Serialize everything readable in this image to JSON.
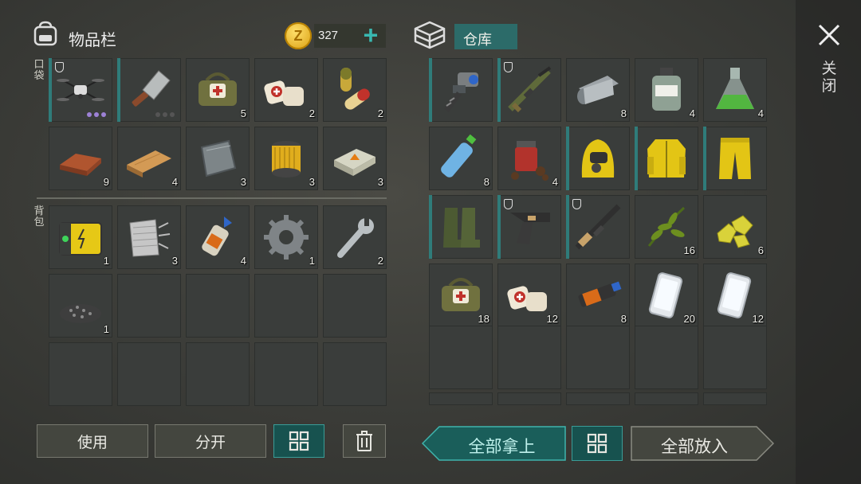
{
  "inventory": {
    "title": "物品栏",
    "pocket_label": "口袋",
    "backpack_label": "背包",
    "coins": "327",
    "coin_symbol": "Z",
    "add_symbol": "+",
    "pocket_slots": [
      {
        "icon": "drone-icon",
        "count": "",
        "shield": true,
        "dots": "purple",
        "rarity": true
      },
      {
        "icon": "cleaver-icon",
        "count": "",
        "shield": false,
        "dots": "gray",
        "rarity": true
      },
      {
        "icon": "medkit-bag-icon",
        "count": "5"
      },
      {
        "icon": "bandage-icon",
        "count": "2"
      },
      {
        "icon": "pills-icon",
        "count": "2"
      },
      {
        "icon": "copper-bar-icon",
        "count": "9"
      },
      {
        "icon": "wood-plank-icon",
        "count": "4"
      },
      {
        "icon": "metal-plate-icon",
        "count": "3"
      },
      {
        "icon": "filter-icon",
        "count": "3"
      },
      {
        "icon": "explosive-block-icon",
        "count": "3"
      }
    ],
    "backpack_slots": [
      {
        "icon": "battery-icon",
        "count": "1"
      },
      {
        "icon": "cloth-icon",
        "count": "3"
      },
      {
        "icon": "glue-icon",
        "count": "4"
      },
      {
        "icon": "gear-icon",
        "count": "1"
      },
      {
        "icon": "wrench-icon",
        "count": "2"
      },
      {
        "icon": "gravel-icon",
        "count": "1"
      },
      {
        "icon": "empty",
        "count": ""
      },
      {
        "icon": "empty",
        "count": ""
      },
      {
        "icon": "empty",
        "count": ""
      },
      {
        "icon": "empty",
        "count": ""
      },
      {
        "icon": "empty",
        "count": ""
      },
      {
        "icon": "empty",
        "count": ""
      },
      {
        "icon": "empty",
        "count": ""
      },
      {
        "icon": "empty",
        "count": ""
      },
      {
        "icon": "empty",
        "count": ""
      }
    ],
    "buttons": {
      "use": "使用",
      "split": "分开"
    }
  },
  "storage": {
    "title": "仓库",
    "slots": [
      {
        "icon": "drill-icon",
        "count": "",
        "rarity": true
      },
      {
        "icon": "rifle-icon",
        "count": "",
        "shield": true,
        "rarity": true
      },
      {
        "icon": "fabric-roll-icon",
        "count": "8"
      },
      {
        "icon": "chemical-bottle-icon",
        "count": "4"
      },
      {
        "icon": "flask-icon",
        "count": "4"
      },
      {
        "icon": "water-bottle-icon",
        "count": "8"
      },
      {
        "icon": "spice-jar-icon",
        "count": "4"
      },
      {
        "icon": "hazmat-hood-icon",
        "count": "",
        "rarity": true
      },
      {
        "icon": "hazmat-jacket-icon",
        "count": "",
        "rarity": true
      },
      {
        "icon": "hazmat-pants-icon",
        "count": "",
        "rarity": true
      },
      {
        "icon": "rubber-boots-icon",
        "count": "",
        "rarity": true
      },
      {
        "icon": "pistol-icon",
        "count": "",
        "shield": true,
        "rarity": true
      },
      {
        "icon": "assault-rifle-icon",
        "count": "",
        "shield": true,
        "rarity": true
      },
      {
        "icon": "herb-icon",
        "count": "16"
      },
      {
        "icon": "sulfur-icon",
        "count": "6"
      },
      {
        "icon": "medkit-bag-icon",
        "count": "18"
      },
      {
        "icon": "bandage-icon",
        "count": "12"
      },
      {
        "icon": "usb-drive-icon",
        "count": "8"
      },
      {
        "icon": "smartphone-icon",
        "count": "20"
      },
      {
        "icon": "smartphone-icon",
        "count": "12"
      }
    ],
    "buttons": {
      "take_all": "全部拿上",
      "put_all": "全部放入"
    }
  },
  "close_label": "关闭",
  "colors": {
    "teal": "#2f7c7a",
    "coin": "#e7b722",
    "purple": "#9d82d6"
  }
}
